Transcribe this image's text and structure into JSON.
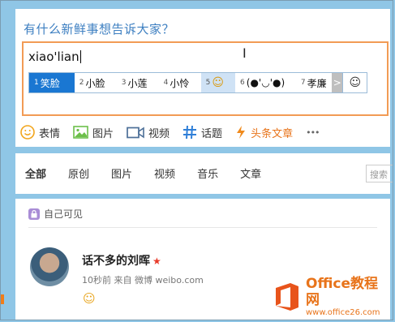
{
  "composer": {
    "prompt": "有什么新鲜事想告诉大家？",
    "typed_text": "xiao'lian"
  },
  "ime": {
    "candidates": [
      {
        "n": "1",
        "text": "笑脸"
      },
      {
        "n": "2",
        "text": "小脸"
      },
      {
        "n": "3",
        "text": "小莲"
      },
      {
        "n": "4",
        "text": "小怜"
      },
      {
        "n": "5",
        "text": "☺"
      },
      {
        "n": "6",
        "text": "(●'◡'●)"
      },
      {
        "n": "7",
        "text": "孝廉"
      }
    ],
    "arrow": ">",
    "smile": "☺"
  },
  "toolbar": {
    "emoji_label": "表情",
    "image_label": "图片",
    "video_label": "视频",
    "topic_label": "话题",
    "article_label": "头条文章",
    "more_label": "•••"
  },
  "feed_tabs": [
    "全部",
    "原创",
    "图片",
    "视频",
    "音乐",
    "文章"
  ],
  "search_placeholder": "搜索",
  "post": {
    "visibility": "自己可见",
    "author": "话不多的刘晖",
    "star": "★",
    "meta": "10秒前 来自 微博 weibo.com",
    "content": "☺"
  },
  "watermark": {
    "title": "Office教程网",
    "url": "www.office26.com"
  },
  "colors": {
    "accent": "#f29b55",
    "ime_select": "#1a77d2",
    "brand_orange": "#e8741b"
  }
}
